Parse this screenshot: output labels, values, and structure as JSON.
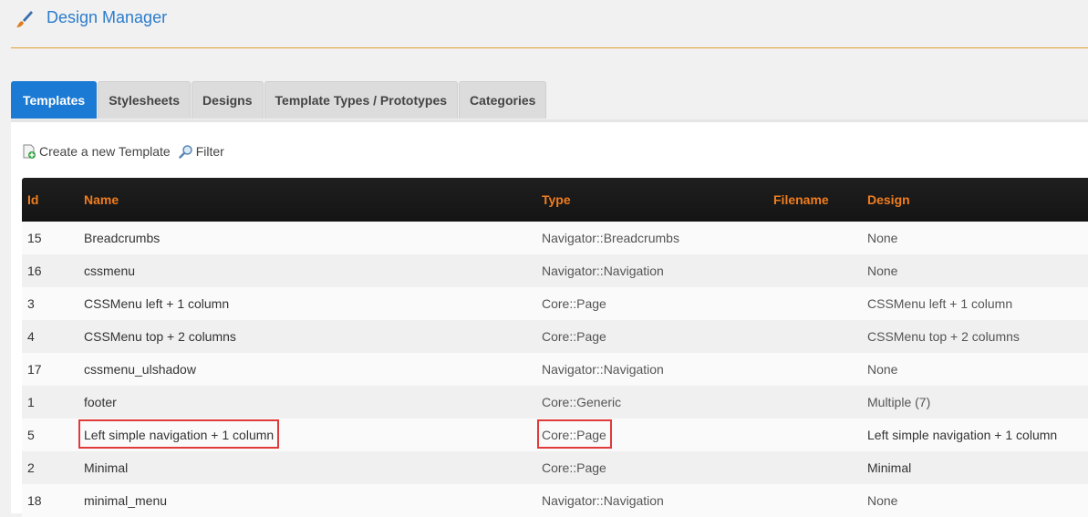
{
  "header": {
    "title": "Design Manager"
  },
  "tabs": [
    {
      "label": "Templates",
      "active": true
    },
    {
      "label": "Stylesheets",
      "active": false
    },
    {
      "label": "Designs",
      "active": false
    },
    {
      "label": "Template Types / Prototypes",
      "active": false
    },
    {
      "label": "Categories",
      "active": false
    }
  ],
  "toolbar": {
    "create_label": "Create a new Template",
    "filter_label": "Filter"
  },
  "table": {
    "headers": {
      "id": "Id",
      "name": "Name",
      "type": "Type",
      "filename": "Filename",
      "design": "Design"
    },
    "rows": [
      {
        "id": "15",
        "name": "Breadcrumbs",
        "type": "Navigator::Breadcrumbs",
        "filename": "",
        "design": "None"
      },
      {
        "id": "16",
        "name": "cssmenu",
        "type": "Navigator::Navigation",
        "filename": "",
        "design": "None"
      },
      {
        "id": "3",
        "name": "CSSMenu left + 1 column",
        "type": "Core::Page",
        "filename": "",
        "design": "CSSMenu left + 1 column"
      },
      {
        "id": "4",
        "name": "CSSMenu top + 2 columns",
        "type": "Core::Page",
        "filename": "",
        "design": "CSSMenu top + 2 columns"
      },
      {
        "id": "17",
        "name": "cssmenu_ulshadow",
        "type": "Navigator::Navigation",
        "filename": "",
        "design": "None"
      },
      {
        "id": "1",
        "name": "footer",
        "type": "Core::Generic",
        "filename": "",
        "design": "Multiple (7)"
      },
      {
        "id": "5",
        "name": "Left simple navigation + 1 column",
        "type": "Core::Page",
        "filename": "",
        "design": "Left simple navigation + 1 column"
      },
      {
        "id": "2",
        "name": "Minimal",
        "type": "Core::Page",
        "filename": "",
        "design": "Minimal"
      },
      {
        "id": "18",
        "name": "minimal_menu",
        "type": "Navigator::Navigation",
        "filename": "",
        "design": "None"
      }
    ]
  },
  "colors": {
    "accent": "#1b7ad3",
    "header_text": "#f07d1e",
    "highlight": "#e03a3a"
  }
}
